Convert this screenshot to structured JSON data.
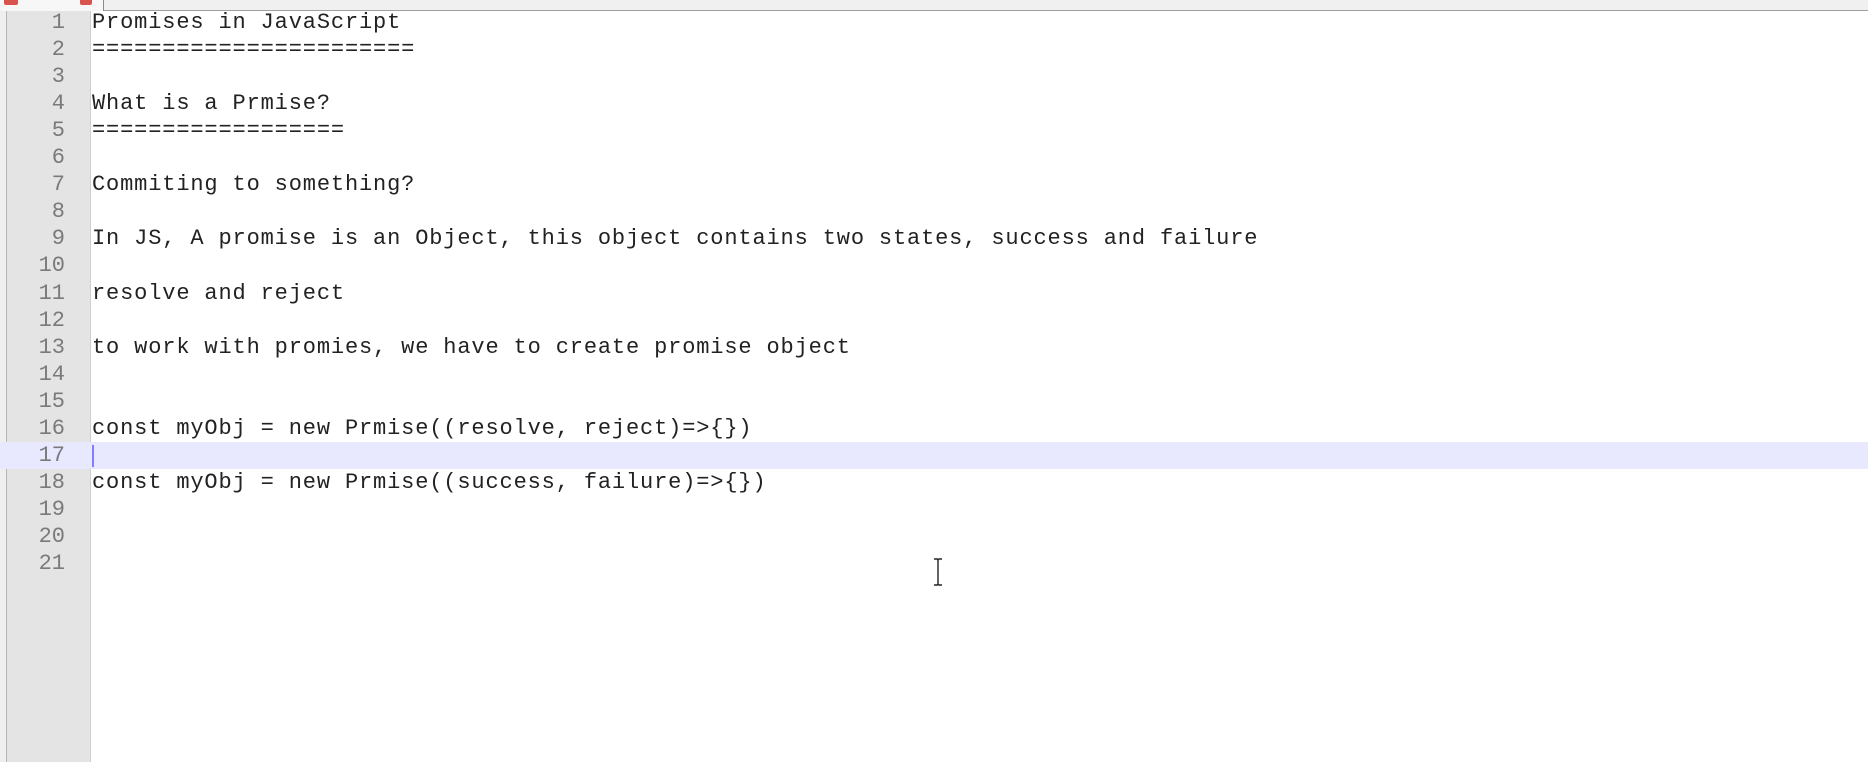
{
  "editor": {
    "lines": [
      {
        "number": "1",
        "text": "Promises in JavaScript"
      },
      {
        "number": "2",
        "text": "======================="
      },
      {
        "number": "3",
        "text": ""
      },
      {
        "number": "4",
        "text": "What is a Prmise?"
      },
      {
        "number": "5",
        "text": "=================="
      },
      {
        "number": "6",
        "text": ""
      },
      {
        "number": "7",
        "text": "Commiting to something?"
      },
      {
        "number": "8",
        "text": ""
      },
      {
        "number": "9",
        "text": "In JS, A promise is an Object, this object contains two states, success and failure"
      },
      {
        "number": "10",
        "text": ""
      },
      {
        "number": "11",
        "text": "resolve and reject"
      },
      {
        "number": "12",
        "text": ""
      },
      {
        "number": "13",
        "text": "to work with promies, we have to create promise object"
      },
      {
        "number": "14",
        "text": ""
      },
      {
        "number": "15",
        "text": ""
      },
      {
        "number": "16",
        "text": "const myObj = new Prmise((resolve, reject)=>{})"
      },
      {
        "number": "17",
        "text": ""
      },
      {
        "number": "18",
        "text": "const myObj = new Prmise((success, failure)=>{})"
      },
      {
        "number": "19",
        "text": ""
      },
      {
        "number": "20",
        "text": ""
      },
      {
        "number": "21",
        "text": ""
      }
    ],
    "current_line": 17,
    "colors": {
      "gutter_bg": "#e4e4e4",
      "current_line_bg": "#e8e8ff",
      "line_number": "#7a7a7a",
      "text": "#222222",
      "caret": "#8080ff",
      "tab_icon": "#d9534f"
    },
    "icons": {
      "tab_icon": "file-modified-icon",
      "tab_close": "close-icon",
      "mouse_cursor": "text-cursor-icon"
    }
  }
}
